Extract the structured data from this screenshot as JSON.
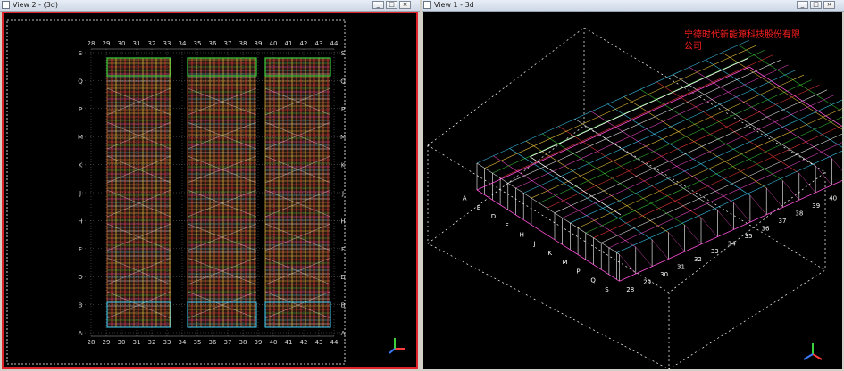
{
  "view2": {
    "title": "View 2 - (3d)",
    "grid_x": [
      "28",
      "29",
      "30",
      "31",
      "32",
      "33",
      "34",
      "35",
      "36",
      "37",
      "38",
      "39",
      "40",
      "41",
      "42",
      "43",
      "44"
    ],
    "grid_y": [
      "S",
      "Q",
      "P",
      "M",
      "K",
      "J",
      "H",
      "F",
      "D",
      "B",
      "A"
    ]
  },
  "view1": {
    "title": "View 1 - 3d",
    "company_line1": "宁德时代新能源科技股份有限",
    "company_line2": "公司"
  },
  "controls": {
    "minimize": "_",
    "restore": "□",
    "close": "×"
  },
  "colors": {
    "active_border": "#e0242c",
    "viewport_bg": "#000000",
    "company_text": "#ff2020",
    "axis_x": "#ff3b3b",
    "axis_y": "#3bd13b",
    "axis_z": "#3b7bff"
  },
  "icons": [
    "window-icon",
    "minimize-icon",
    "restore-icon",
    "close-icon",
    "axis-triad-icon"
  ]
}
